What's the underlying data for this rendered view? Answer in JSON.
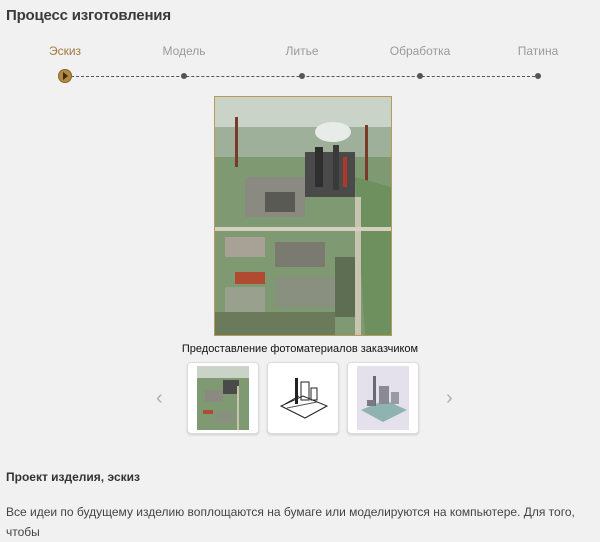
{
  "header": {
    "title": "Процесс изготовления"
  },
  "steps": [
    {
      "label": "Эскиз",
      "active": true
    },
    {
      "label": "Модель",
      "active": false
    },
    {
      "label": "Литье",
      "active": false
    },
    {
      "label": "Обработка",
      "active": false
    },
    {
      "label": "Патина",
      "active": false
    }
  ],
  "gallery": {
    "caption": "Предоставление фотоматериалов заказчиком",
    "prev_icon": "‹",
    "next_icon": "›",
    "thumbnails": [
      {
        "kind": "aerial-photo"
      },
      {
        "kind": "sketch"
      },
      {
        "kind": "3d-model"
      }
    ]
  },
  "section": {
    "title": "Проект изделия, эскиз",
    "text": "Все идеи по будущему изделию воплощаются на бумаге или моделируются на компьютере. Для того, чтобы"
  },
  "colors": {
    "accent": "#a07a3a",
    "text": "#333333",
    "background": "#f1f1f1"
  }
}
